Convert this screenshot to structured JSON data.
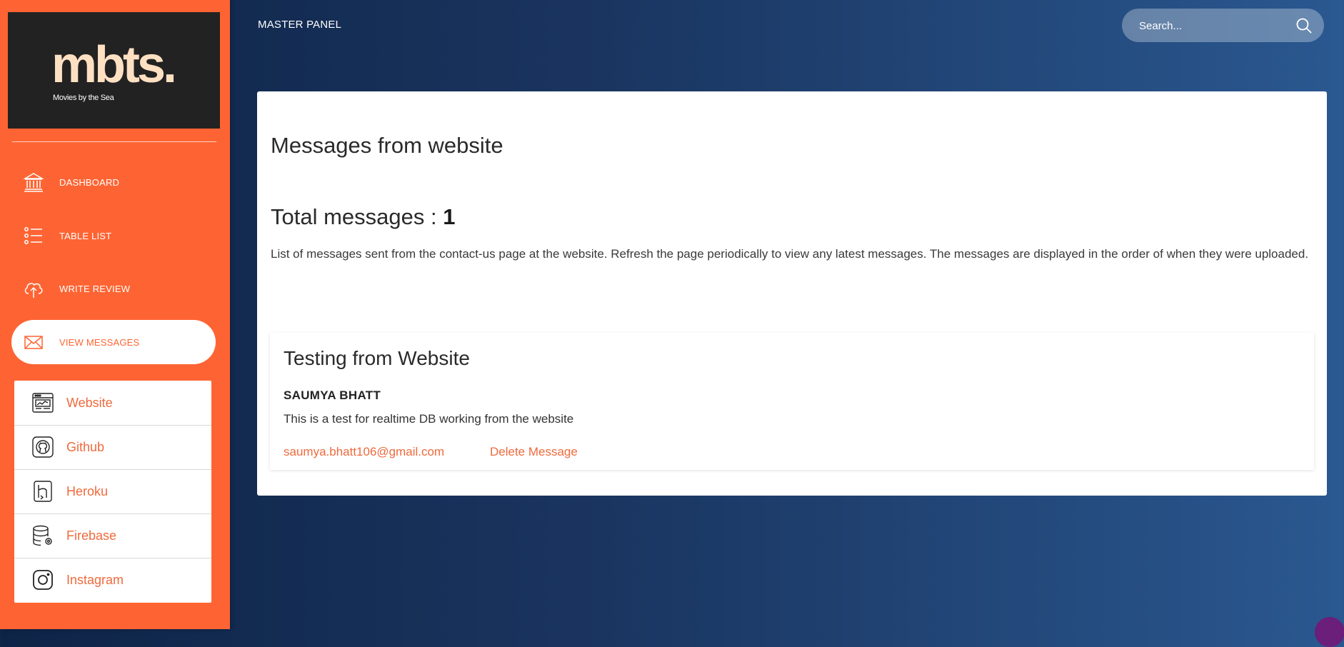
{
  "brand": {
    "logo": "mbts.",
    "tagline": "Movies by the Sea"
  },
  "sidebar": {
    "items": [
      {
        "label": "DASHBOARD",
        "icon": "bank-icon"
      },
      {
        "label": "TABLE LIST",
        "icon": "list-icon"
      },
      {
        "label": "WRITE REVIEW",
        "icon": "cloud-upload-icon"
      },
      {
        "label": "VIEW MESSAGES",
        "icon": "envelope-icon",
        "active": true
      }
    ],
    "links": [
      {
        "label": "Website",
        "icon": "browser-window-icon"
      },
      {
        "label": "Github",
        "icon": "github-icon"
      },
      {
        "label": "Heroku",
        "icon": "heroku-icon"
      },
      {
        "label": "Firebase",
        "icon": "database-gear-icon"
      },
      {
        "label": "Instagram",
        "icon": "instagram-icon"
      }
    ]
  },
  "topbar": {
    "title": "MASTER PANEL",
    "search_placeholder": "Search..."
  },
  "main": {
    "title": "Messages from website",
    "total_label": "Total messages :",
    "total_count": "1",
    "description": "List of messages sent from the contact-us page at the website. Refresh the page periodically to view any latest messages. The messages are displayed in the order of when they were uploaded.",
    "messages": [
      {
        "subject": "Testing from Website",
        "name": "SAUMYA BHATT",
        "body": "This is a test for realtime DB working from the website",
        "email": "saumya.bhatt106@gmail.com",
        "delete_label": "Delete Message"
      }
    ]
  },
  "colors": {
    "accent": "#fe6433",
    "link": "#ef6a3d",
    "logo_bg": "#232222",
    "logo_text": "#fde0c2"
  }
}
